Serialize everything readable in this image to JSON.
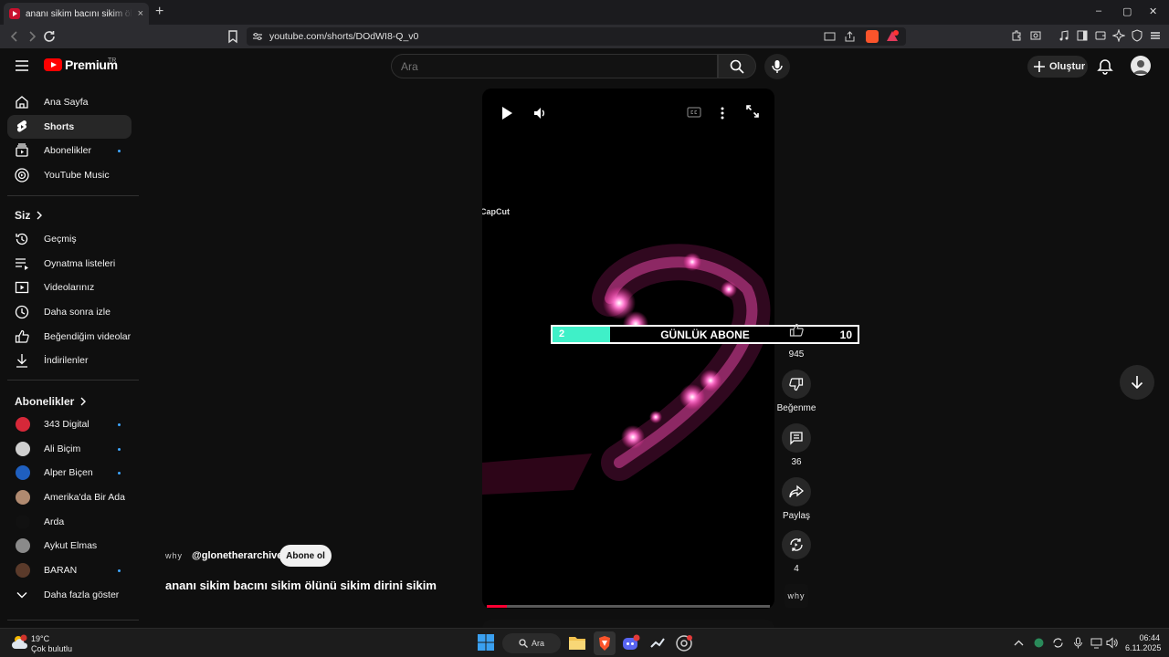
{
  "browser": {
    "tab_title": "ananı sikim bacını sikim ölünü sikim dirini sikim",
    "tab_close": "×",
    "new_tab": "+",
    "url": "youtube.com/shorts/DOdWI8-Q_v0",
    "window_controls": [
      "–",
      "▢",
      "✕"
    ]
  },
  "header": {
    "logo_text": "Premium",
    "region": "TR",
    "search_placeholder": "Ara",
    "create_label": "Oluştur"
  },
  "sidebar": {
    "main": [
      {
        "label": "Ana Sayfa",
        "icon": "home-icon"
      },
      {
        "label": "Shorts",
        "icon": "shorts-icon",
        "active": true
      },
      {
        "label": "Abonelikler",
        "icon": "subscriptions-icon",
        "dot": true
      },
      {
        "label": "YouTube Music",
        "icon": "music-icon"
      }
    ],
    "you_heading": "Siz",
    "you": [
      {
        "label": "Geçmiş",
        "icon": "history-icon"
      },
      {
        "label": "Oynatma listeleri",
        "icon": "playlists-icon"
      },
      {
        "label": "Videolarınız",
        "icon": "your-videos-icon"
      },
      {
        "label": "Daha sonra izle",
        "icon": "watch-later-icon"
      },
      {
        "label": "Beğendiğim videolar",
        "icon": "liked-icon"
      },
      {
        "label": "İndirilenler",
        "icon": "download-icon"
      }
    ],
    "subs_heading": "Abonelikler",
    "subs": [
      {
        "label": "343 Digital",
        "color": "#d62839",
        "dot": true
      },
      {
        "label": "Ali Biçim",
        "color": "#cfcfcf",
        "dot": true
      },
      {
        "label": "Alper Biçen",
        "color": "#1f5fbf",
        "dot": true
      },
      {
        "label": "Amerika'da Bir Ada",
        "color": "#b08a70",
        "dot": false
      },
      {
        "label": "Arda",
        "color": "#111111",
        "dot": false
      },
      {
        "label": "Aykut Elmas",
        "color": "#8a8a8a",
        "dot": false
      },
      {
        "label": "BARAN",
        "color": "#5a3a2a",
        "dot": true
      }
    ],
    "show_more": "Daha fazla göster"
  },
  "player": {
    "watermark": "CapCut",
    "progress": 0.07,
    "overlay": {
      "start": "2",
      "title": "GÜNLÜK ABONE",
      "end": "10",
      "fill": 0.19
    }
  },
  "actions": {
    "likes": "945",
    "dislike": "Beğenme",
    "comments": "36",
    "share": "Paylaş",
    "remix": "4",
    "sound_thumb": "why"
  },
  "channel": {
    "avatar_text": "why",
    "handle": "@glonetherarchive",
    "subscribe": "Abone ol",
    "title": "ananı sikim bacını sikim ölünü sikim dirini sikim"
  },
  "taskbar": {
    "temp": "19°C",
    "condition": "Çok bulutlu",
    "search": "Ara",
    "time": "06:44",
    "date": "6.11.2025"
  }
}
